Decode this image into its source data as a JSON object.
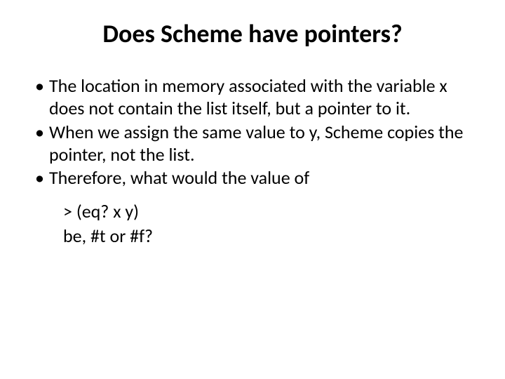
{
  "title": "Does Scheme have pointers?",
  "bullets": [
    "The location in memory associated with the variable x does not contain the list itself, but a pointer to it.",
    "When we assign the same value to y, Scheme copies the pointer, not the list.",
    "Therefore,  what would the value of"
  ],
  "code": {
    "line1": ">  (eq?  x  y)",
    "line2": "be,  #t or #f?"
  }
}
